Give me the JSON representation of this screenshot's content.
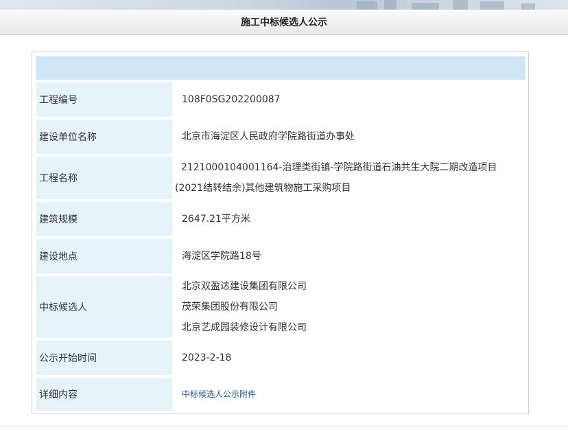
{
  "page": {
    "title": "施工中标候选人公示"
  },
  "rows": [
    {
      "label": "工程编号",
      "lines": [
        "108F0SG202200087"
      ]
    },
    {
      "label": "建设单位名称",
      "lines": [
        "北京市海淀区人民政府学院路街道办事处"
      ]
    },
    {
      "label": "工程名称",
      "lines": [
        "  2121000104001164-治理类街镇-学院路街道石油共生大院二期改造项目",
        "(2021结转结余)其他建筑物施工采购项目"
      ]
    },
    {
      "label": "建筑规模",
      "lines": [
        "2647.21平方米"
      ]
    },
    {
      "label": "建设地点",
      "lines": [
        "海淀区学院路18号"
      ]
    },
    {
      "label": "中标候选人",
      "lines": [
        "北京双盈达建设集团有限公司",
        "茂荣集团股份有限公司",
        "北京艺成园装修设计有限公司"
      ]
    },
    {
      "label": "公示开始时间",
      "lines": [
        "2023-2-18"
      ]
    },
    {
      "label": "详细内容",
      "link": "中标候选人公示附件"
    }
  ]
}
